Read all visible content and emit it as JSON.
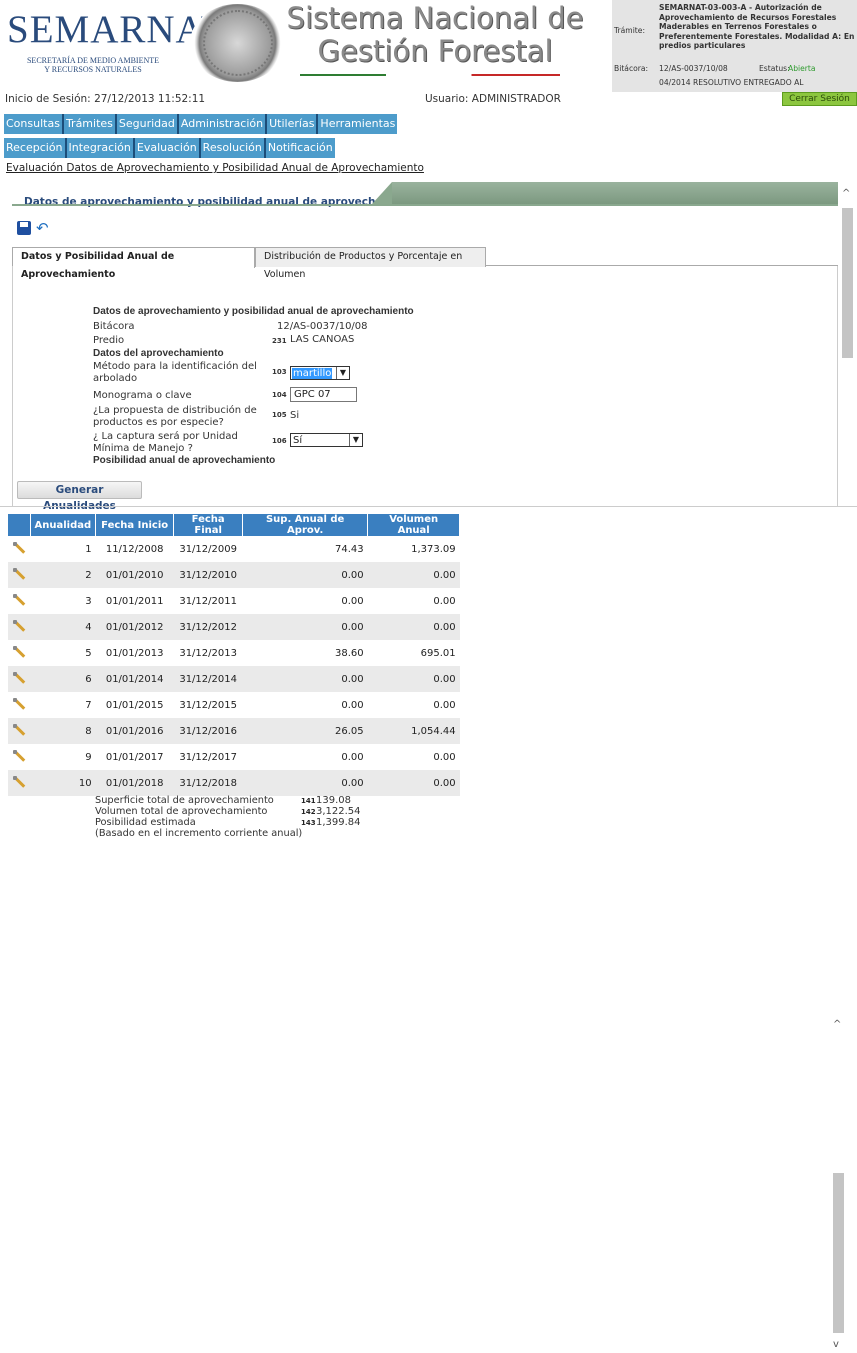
{
  "header": {
    "logo_text": "SEMARNAT",
    "logo_sub1": "SECRETARÍA DE MEDIO AMBIENTE",
    "logo_sub2": "Y RECURSOS NATURALES",
    "system_title_1": "Sistema Nacional de",
    "system_title_2": "Gestión Forestal",
    "tramite_label": "Trámite:",
    "tramite_value": "SEMARNAT-03-003-A - Autorización de Aprovechamiento de Recursos Forestales Maderables en Terrenos Forestales o Preferentemente Forestales. Modalidad A: En predios particulares",
    "bitacora_label": "Bitácora:",
    "bitacora_value": "12/AS-0037/10/08",
    "estatus_label": "Estatus:",
    "estatus_value": "Abierta",
    "extra_line": "04/2014 RESOLUTIVO ENTREGADO AL"
  },
  "session": {
    "start_label": "Inicio de Sesión:",
    "start_value": "27/12/2013 11:52:11",
    "user_label": "Usuario:",
    "user_value": "ADMINISTRADOR",
    "logout_label": "Cerrar Sesión"
  },
  "menu1": [
    "Consultas",
    "Trámites",
    "Seguridad",
    "Administración",
    "Utilerías",
    "Herramientas"
  ],
  "menu2": [
    "Recepción",
    "Integración",
    "Evaluación",
    "Resolución",
    "Notificación"
  ],
  "breadcrumb": "Evaluación  Datos de Aprovechamiento y Posibilidad Anual de Aprovechamiento",
  "panel_title": "Datos de aprovechamiento y posibilidad anual de aprovechamiento",
  "tabs": [
    "Datos y Posibilidad Anual de Aprovechamiento",
    "Distribución de Productos y Porcentaje en Volumen"
  ],
  "form": {
    "section_title": "Datos de aprovechamiento y posibilidad anual de aprovechamiento",
    "bitacora_label": "Bitácora",
    "bitacora_value": "12/AS-0037/10/08",
    "predio_label": "Predio",
    "predio_num": "231",
    "predio_value": "LAS CANOAS",
    "aprov_title": "Datos del aprovechamiento",
    "metodo_label_1": "Método para la identificación del",
    "metodo_label_2": "arbolado",
    "metodo_num": "103",
    "metodo_value": "martillo",
    "monograma_label": "Monograma o clave",
    "monograma_num": "104",
    "monograma_value": "GPC 07",
    "propuesta_label_1": "¿La propuesta de distribución de",
    "propuesta_label_2": "productos es por especie?",
    "propuesta_num": "105",
    "propuesta_value": "Si",
    "captura_label_1": "¿ La captura será por Unidad",
    "captura_label_2": "Mínima de Manejo ?",
    "captura_num": "106",
    "captura_value": "Sí",
    "posibilidad_title": "Posibilidad anual de aprovechamiento",
    "generate_button": "Generar Anualidades"
  },
  "grid": {
    "headers": [
      "Anualidad",
      "Fecha Inicio",
      "Fecha Final",
      "Sup. Anual de Aprov.",
      "Volumen Anual"
    ],
    "rows": [
      [
        "1",
        "11/12/2008",
        "31/12/2009",
        "74.43",
        "1,373.09"
      ],
      [
        "2",
        "01/01/2010",
        "31/12/2010",
        "0.00",
        "0.00"
      ],
      [
        "3",
        "01/01/2011",
        "31/12/2011",
        "0.00",
        "0.00"
      ],
      [
        "4",
        "01/01/2012",
        "31/12/2012",
        "0.00",
        "0.00"
      ],
      [
        "5",
        "01/01/2013",
        "31/12/2013",
        "38.60",
        "695.01"
      ],
      [
        "6",
        "01/01/2014",
        "31/12/2014",
        "0.00",
        "0.00"
      ],
      [
        "7",
        "01/01/2015",
        "31/12/2015",
        "0.00",
        "0.00"
      ],
      [
        "8",
        "01/01/2016",
        "31/12/2016",
        "26.05",
        "1,054.44"
      ],
      [
        "9",
        "01/01/2017",
        "31/12/2017",
        "0.00",
        "0.00"
      ],
      [
        "10",
        "01/01/2018",
        "31/12/2018",
        "0.00",
        "0.00"
      ]
    ]
  },
  "totals": {
    "sup_label": "Superficie total de aprovechamiento",
    "sup_num": "141",
    "sup_value": "139.08",
    "vol_label": "Volumen total de aprovechamiento",
    "vol_num": "142",
    "vol_value": "3,122.54",
    "pos_label": "Posibilidad estimada",
    "pos_num": "143",
    "pos_value": "1,399.84",
    "note": "(Basado en el incremento corriente anual)"
  }
}
